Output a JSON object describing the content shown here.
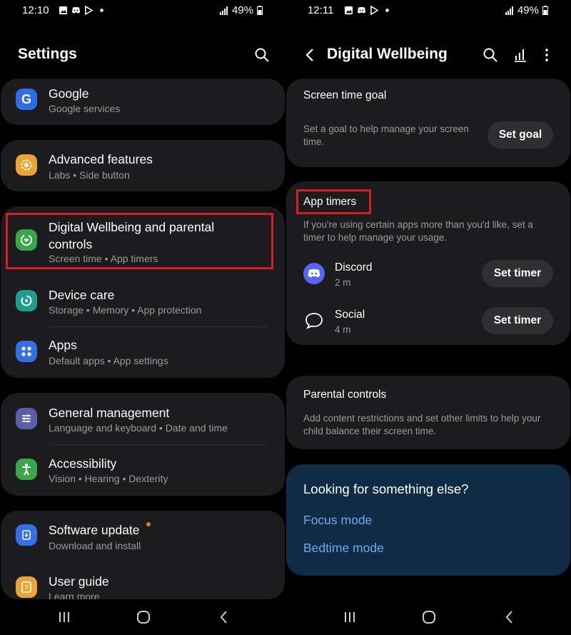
{
  "left": {
    "status": {
      "time": "12:10",
      "battery": "49%"
    },
    "title": "Settings",
    "items": [
      {
        "title": "Google",
        "subtitle": "Google services"
      },
      {
        "title": "Advanced features",
        "subtitle": "Labs  •  Side button"
      },
      {
        "title": "Digital Wellbeing and parental controls",
        "subtitle": "Screen time  •  App timers"
      },
      {
        "title": "Device care",
        "subtitle": "Storage  •  Memory  •  App protection"
      },
      {
        "title": "Apps",
        "subtitle": "Default apps  •  App settings"
      },
      {
        "title": "General management",
        "subtitle": "Language and keyboard  •  Date and time"
      },
      {
        "title": "Accessibility",
        "subtitle": "Vision  •  Hearing  •  Dexterity"
      },
      {
        "title": "Software update",
        "subtitle": "Download and install"
      },
      {
        "title": "User guide",
        "subtitle": "Learn more"
      }
    ],
    "colors": {
      "google": "#2d6ee6",
      "advanced": "#e8a534",
      "wellbeing": "#3aa64a",
      "device_care": "#1e9c8d",
      "apps": "#3470e4",
      "general": "#5a5fa8",
      "accessibility": "#3aa64a",
      "software": "#3470e4",
      "guide": "#e8a534",
      "highlight": "#d81e25"
    }
  },
  "right": {
    "status": {
      "time": "12:11",
      "battery": "49%"
    },
    "title": "Digital Wellbeing",
    "screen_time_goal": {
      "title": "Screen time goal",
      "description": "Set a goal to help manage your screen time.",
      "button": "Set goal"
    },
    "app_timers": {
      "title": "App timers",
      "description": "If you're using certain apps more than you'd like, set a timer to help manage your usage.",
      "apps": [
        {
          "name": "Discord",
          "time": "2 m",
          "button": "Set timer",
          "icon": "discord-icon"
        },
        {
          "name": "Social",
          "time": "4 m",
          "button": "Set timer",
          "icon": "chat-bubble-icon"
        }
      ]
    },
    "parental_controls": {
      "title": "Parental controls",
      "description": "Add content restrictions and set other limits to help your child balance their screen time."
    },
    "looking": {
      "title": "Looking for something else?",
      "links": [
        "Focus mode",
        "Bedtime mode"
      ]
    }
  }
}
